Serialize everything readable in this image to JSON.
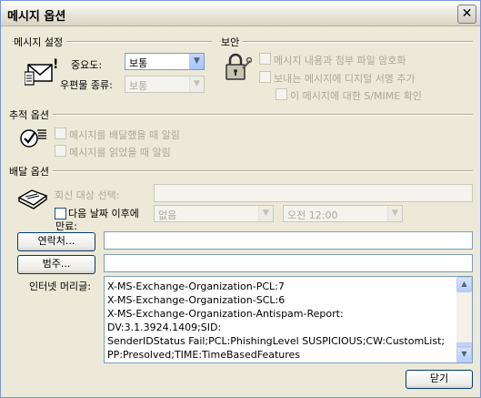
{
  "window": {
    "title": "메시지 옵션",
    "close_glyph": "✕"
  },
  "message_settings": {
    "group_label": "메시지 설정",
    "importance_label": "중요도:",
    "importance_value": "보통",
    "sensitivity_label": "우편물 종류:",
    "sensitivity_value": "보통",
    "icon": "envelope-importance-icon"
  },
  "security": {
    "group_label": "보안",
    "encrypt_label": "메시지 내용과 첨부 파일 암호화",
    "sign_label": "보내는 메시지에 디지털 서명 추가",
    "smime_label": "이 메시지에 대한 S/MIME 확인",
    "icon": "lock-key-icon"
  },
  "tracking": {
    "group_label": "추적 옵션",
    "delivered_label": "메시지를 배달했을 때 알림",
    "read_label": "메시지를 읽었을 때 알림",
    "icon": "checkmark-envelope-icon"
  },
  "delivery": {
    "group_label": "배달 옵션",
    "reply_to_label": "회신 대상 선택:",
    "expire_label_1": "다음 날짜 이후에",
    "expire_label_2": "만료:",
    "expire_date_value": "없음",
    "expire_time_value": "오전 12:00",
    "icon": "outbox-tray-icon"
  },
  "contacts": {
    "contacts_button": "연락처...",
    "categories_button": "범주..."
  },
  "internet_headers": {
    "label": "인터넷 머리글:",
    "text": "X-MS-Exchange-Organization-PCL:7\nX-MS-Exchange-Organization-SCL:6\nX-MS-Exchange-Organization-Antispam-Report: DV:3.1.3924.1409;SID:\nSenderIDStatus Fail;PCL:PhishingLevel SUSPICIOUS;CW:CustomList;\nPP:Presolved;TIME:TimeBasedFeatures"
  },
  "footer": {
    "close_button": "닫기"
  }
}
